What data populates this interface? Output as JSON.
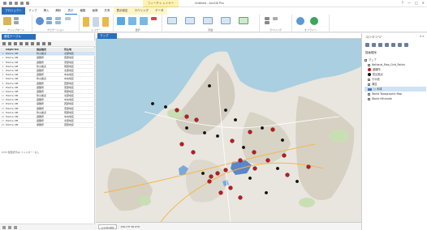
{
  "window": {
    "context_tab": "フィーチャ レイヤー",
    "app_title": "Untitled - ArcGIS Pro",
    "controls": [
      "?",
      "—",
      "□",
      "✕"
    ]
  },
  "ribbon": {
    "tabs": [
      "プロジェクト",
      "マップ",
      "挿入",
      "解析",
      "表示",
      "編集",
      "画像",
      "共有",
      "表示設定",
      "ラベリング",
      "データ"
    ],
    "groups": [
      "クリップボード",
      "ナビゲーション",
      "レイヤー",
      "選択",
      "照会",
      "ラベリング",
      "オフライン"
    ]
  },
  "attribute_table": {
    "tab_label": "属性テーブル",
    "headers": [
      "",
      "OBJECTID",
      "施設種別",
      "所在地"
    ],
    "rows": [
      [
        "1",
        "Point ▸ SM",
        "防災拠点",
        "北部地区"
      ],
      [
        "2",
        "Point ▸ SM",
        "避難所",
        "西部地区"
      ],
      [
        "3",
        "Point ▸ SM",
        "避難所",
        "東部地区"
      ],
      [
        "4",
        "Point ▸ SM",
        "防災拠点",
        "南部地区"
      ],
      [
        "5",
        "Point ▸ SM",
        "避難所",
        "北部地区"
      ],
      [
        "6",
        "Point ▸ SM",
        "避難所",
        "中央地区"
      ],
      [
        "7",
        "Point ▸ SM",
        "防災拠点",
        "中央地区"
      ],
      [
        "8",
        "Point ▸ SM",
        "避難所",
        "西部地区"
      ],
      [
        "9",
        "Point ▸ SM",
        "避難所",
        "東部地区"
      ],
      [
        "10",
        "Point ▸ SM",
        "避難所",
        "南部地区"
      ],
      [
        "11",
        "Point ▸ SM",
        "防災拠点",
        "北部地区"
      ],
      [
        "12",
        "Point ▸ SM",
        "避難所",
        "中央地区"
      ],
      [
        "13",
        "Point ▸ SM",
        "避難所",
        "西部地区"
      ],
      [
        "14",
        "Point ▸ SM",
        "避難所",
        "東部地区"
      ],
      [
        "15",
        "Point ▸ SM",
        "防災拠点",
        "南部地区"
      ],
      [
        "16",
        "Point ▸ SM",
        "避難所",
        "中央地区"
      ],
      [
        "17",
        "Point ▸ SM",
        "避難所",
        "北部地区"
      ],
      [
        "18",
        "Point ▸ SM",
        "避難所",
        "西部地区"
      ]
    ],
    "footer": "0/33 個選択済み フィルター: なし"
  },
  "map": {
    "tab_label": "マップ",
    "scale": "1:100,000",
    "coordinates": "139.1°E 36.4°N"
  },
  "contents": {
    "title": "コンテンツ",
    "subtitle": "描画順序",
    "items": [
      {
        "label": "マップ",
        "sym": "chk"
      },
      {
        "label": "National_Map_Grid_Points",
        "sym": "chk"
      },
      {
        "label": "避難所",
        "sym": "red"
      },
      {
        "label": "防災拠点",
        "sym": "black"
      },
      {
        "label": "その他",
        "sym": "chk"
      },
      {
        "label": "湖沼",
        "sym": "chk"
      },
      {
        "label": "□ 水域",
        "sym": "rect"
      },
      {
        "label": "World Topographic Map",
        "sym": "chk"
      },
      {
        "label": "World Hillshade",
        "sym": "chk"
      }
    ]
  },
  "colors": {
    "accent": "#2a6ebb",
    "sea": "#a9cfe0",
    "land": "#e9e6df",
    "point_red": "#c8151b",
    "point_black": "#111111",
    "water": "#5b86c9"
  }
}
